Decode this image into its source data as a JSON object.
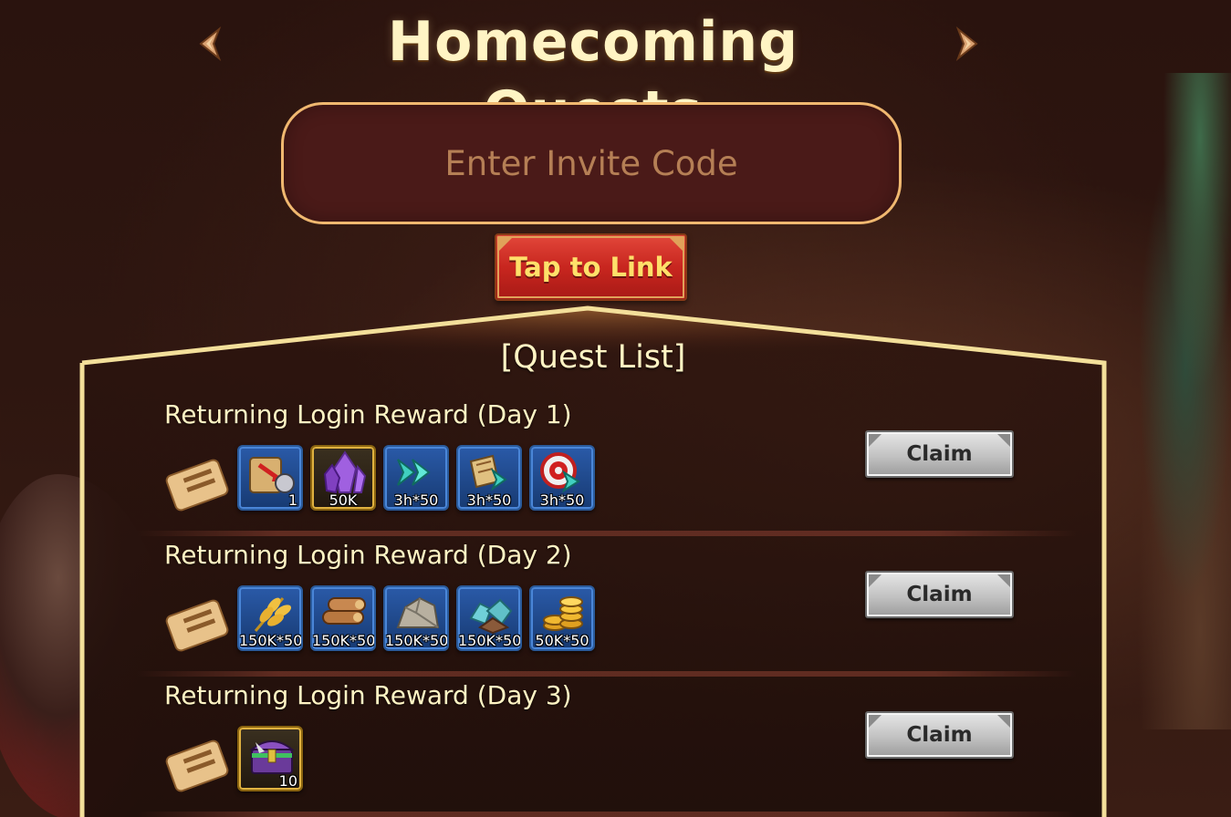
{
  "header": {
    "title": "Homecoming Quests"
  },
  "invite": {
    "placeholder": "Enter Invite Code",
    "value": ""
  },
  "link_button": {
    "label": "Tap to Link"
  },
  "quest_list": {
    "title": "[Quest List]",
    "quests": [
      {
        "title": "Returning Login Reward (Day 1)",
        "claim_label": "Claim",
        "rewards": [
          {
            "icon": "scroll-helmet-icon",
            "qty": "1"
          },
          {
            "icon": "purple-crystal-icon",
            "qty": "50K"
          },
          {
            "icon": "speedup-arrows-icon",
            "qty": "3h*50"
          },
          {
            "icon": "research-speedup-icon",
            "qty": "3h*50"
          },
          {
            "icon": "training-speedup-icon",
            "qty": "3h*50"
          }
        ]
      },
      {
        "title": "Returning Login Reward (Day 2)",
        "claim_label": "Claim",
        "rewards": [
          {
            "icon": "wheat-icon",
            "qty": "150K*50"
          },
          {
            "icon": "wood-logs-icon",
            "qty": "150K*50"
          },
          {
            "icon": "stone-icon",
            "qty": "150K*50"
          },
          {
            "icon": "iron-ore-icon",
            "qty": "150K*50"
          },
          {
            "icon": "gold-coins-icon",
            "qty": "50K*50"
          }
        ]
      },
      {
        "title": "Returning Login Reward (Day 3)",
        "claim_label": "Claim",
        "rewards": [
          {
            "icon": "treasure-chest-icon",
            "qty": "10"
          }
        ]
      }
    ]
  },
  "colors": {
    "title": "#fff4c4",
    "panel_border": "#f3df9a",
    "link_button": "#c8261f",
    "link_text": "#ffe06a",
    "input_border": "#f0b870"
  }
}
